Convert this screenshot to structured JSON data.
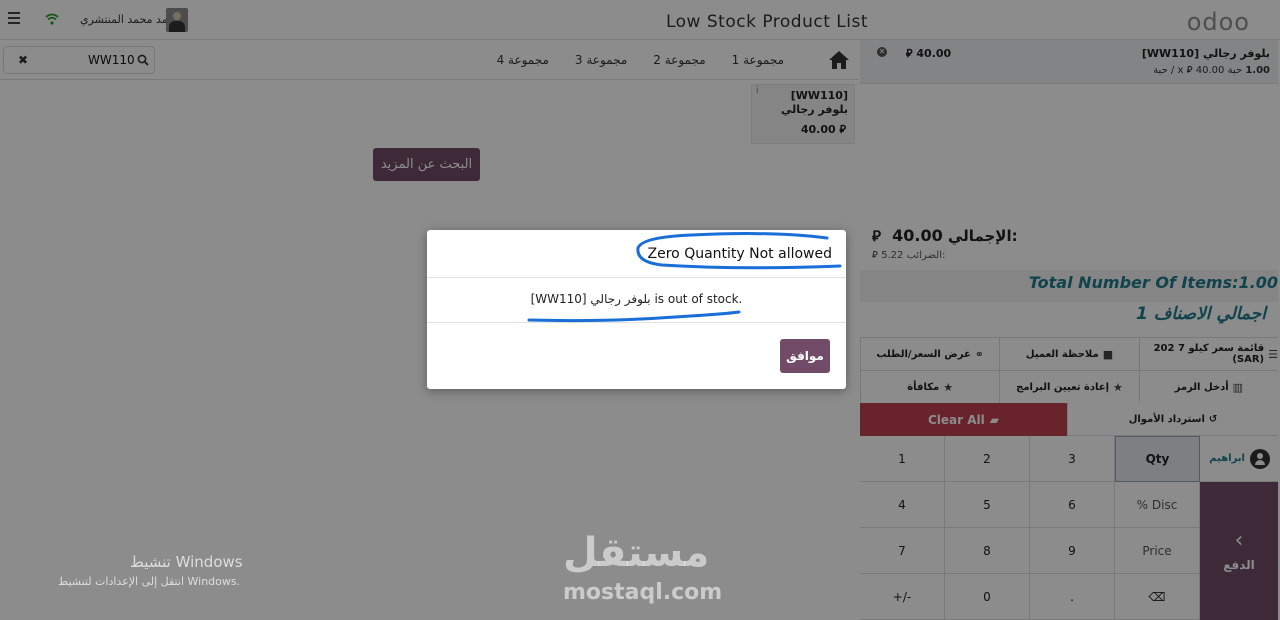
{
  "header": {
    "title": "Low Stock Product List",
    "logo": "odoo",
    "user_name": "احمد محمد المنتشري",
    "wifi_icon": "wifi-icon"
  },
  "search": {
    "value": "WW110",
    "clear_label": "✖"
  },
  "categories": [
    "مجموعة 1",
    "مجموعة 2",
    "مجموعة 3",
    "مجموعة 4"
  ],
  "products": [
    {
      "name": "[WW110] بلوفر رجالي",
      "price": "40.00 ⃁",
      "info": "i"
    }
  ],
  "load_more_label": "البحث عن المزيد",
  "order": {
    "line": {
      "name": "[WW110] بلوفر رجالي",
      "qty": "1.00",
      "unit": "حبة",
      "unit_price": "40.00",
      "currency": "⃁",
      "per_unit": "x / حبة",
      "price": "40.00"
    },
    "total_label": "الإجمالي:",
    "total_value": "40.00",
    "taxes_label": "الضرائب:",
    "taxes_value": "5.22",
    "items_count": "Total Number Of Items:1.00",
    "items_count_ar": "اجمالي الاصناف 1"
  },
  "controls": {
    "row1": [
      "قائمة سعر كيلو 7 202 (SAR)",
      "ملاحظة العميل",
      "عرض السعر/الطلب"
    ],
    "row2": [
      "أدخل الرمز",
      "إعادة تعيين البرامج",
      "مكافأة"
    ],
    "refund": "استرداد الأموال",
    "clear_all": "Clear All"
  },
  "numpad": [
    "1",
    "2",
    "3",
    "Qty",
    "4",
    "5",
    "6",
    "% Disc",
    "7",
    "8",
    "9",
    "Price",
    "+/-",
    "0",
    ".",
    "⌫"
  ],
  "customer_name": "ابراهيم",
  "pay_label": "الدفع",
  "modal": {
    "title": "Zero Quantity Not allowed",
    "message": "[WW110] بلوفر رجالي is out of stock.",
    "ok_label": "موافق"
  },
  "watermarks": {
    "windows_title": "تنشيط Windows",
    "windows_sub": "انتقل إلى الإعدادات لتنشيط Windows.",
    "mostaql_ar": "مستقل",
    "mostaql_en": "mostaql.com"
  },
  "colors": {
    "brand": "#714b67",
    "danger": "#c0404d",
    "teal": "#1f7a8c",
    "annotation": "#1a6ed8"
  }
}
